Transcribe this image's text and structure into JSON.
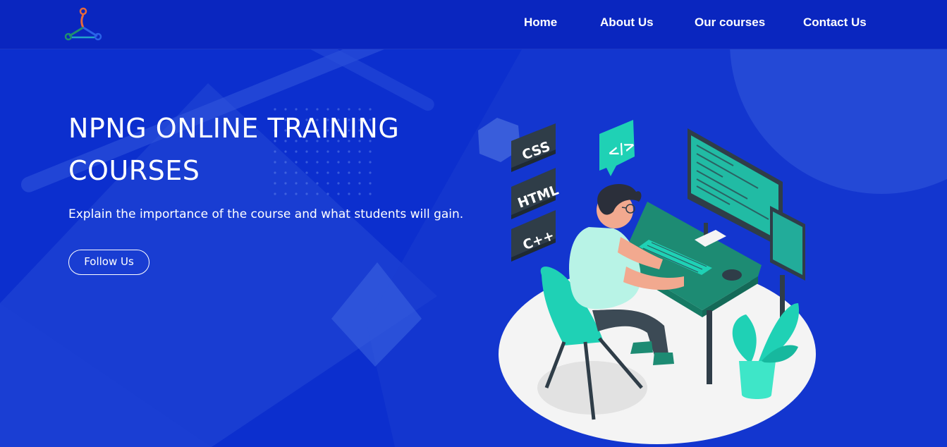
{
  "header": {
    "logo_icon": "people-network-logo",
    "nav": [
      {
        "label": "Home"
      },
      {
        "label": "About Us"
      },
      {
        "label": "Our courses"
      },
      {
        "label": "Contact Us"
      }
    ]
  },
  "hero": {
    "title_line1": "NPNG ONLINE TRAINING",
    "title_line2": "COURSES",
    "description": "Explain the importance of the course and what students will gain.",
    "follow_label": "Follow Us"
  },
  "illustration": {
    "tags": [
      "CSS",
      "HTML",
      "C++"
    ],
    "code_badge": "</>"
  },
  "colors": {
    "background": "#0c2fce",
    "navbar": "#0a26bf",
    "accent_teal": "#1fd1b5",
    "text": "#ffffff"
  }
}
